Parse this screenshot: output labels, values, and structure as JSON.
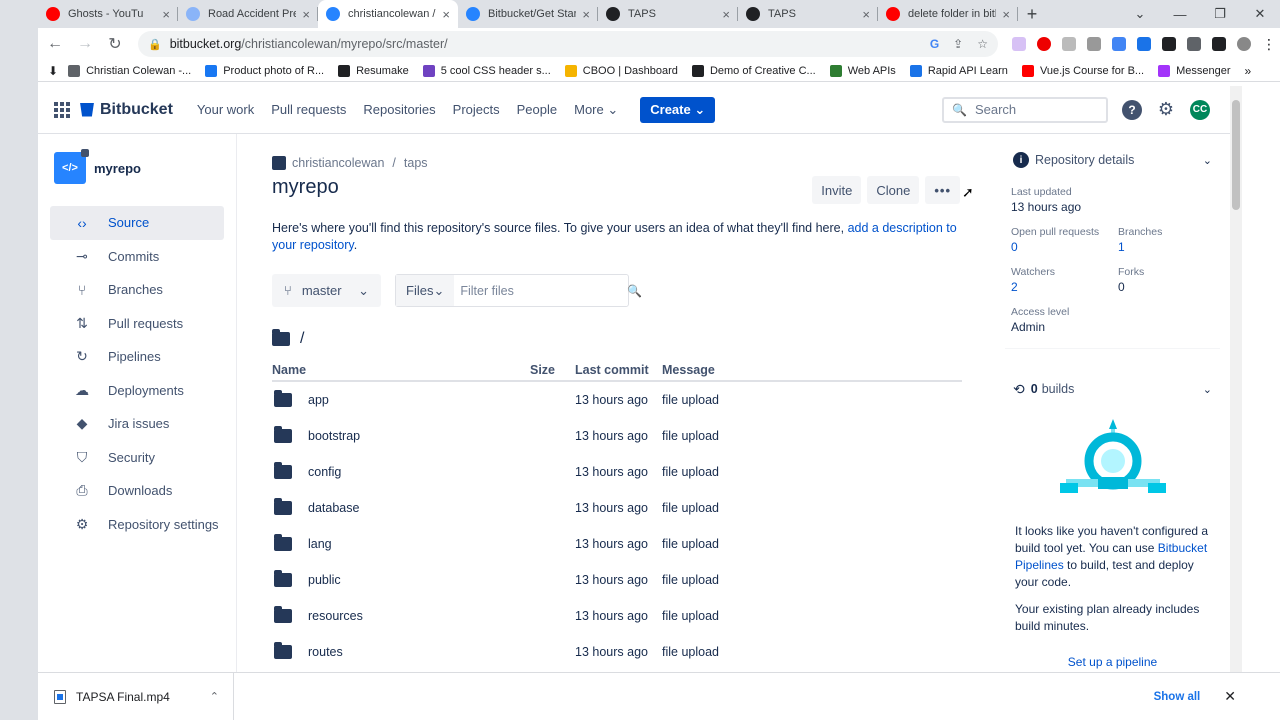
{
  "browser": {
    "tabs": [
      {
        "title": "Ghosts - YouTu",
        "color": "#ff0000",
        "active": false
      },
      {
        "title": "Road Accident Pre",
        "color": "#8ab4f8",
        "active": false
      },
      {
        "title": "christiancolewan / r",
        "color": "#2684ff",
        "active": true
      },
      {
        "title": "Bitbucket/Get Start",
        "color": "#2684ff",
        "active": false
      },
      {
        "title": "TAPS",
        "color": "#202124",
        "active": false
      },
      {
        "title": "TAPS",
        "color": "#202124",
        "active": false
      },
      {
        "title": "delete folder in bitb",
        "color": "#ff0000",
        "active": false
      }
    ],
    "url_host": "bitbucket.org",
    "url_path": "/christiancolewan/myrepo/src/master/",
    "bookmarks": [
      {
        "label": "Christian Colewan -...",
        "color": "#5f6368"
      },
      {
        "label": "Product photo of R...",
        "color": "#1877f2"
      },
      {
        "label": "Resumake",
        "color": "#202124"
      },
      {
        "label": "5 cool CSS header s...",
        "color": "#6f42c1"
      },
      {
        "label": "CBOO | Dashboard",
        "color": "#f5b400"
      },
      {
        "label": "Demo of Creative C...",
        "color": "#202124"
      },
      {
        "label": "Web APIs",
        "color": "#2e7d32"
      },
      {
        "label": "Rapid API Learn",
        "color": "#1a73e8"
      },
      {
        "label": "Vue.js Course for B...",
        "color": "#ff0000"
      },
      {
        "label": "Messenger",
        "color": "#a334fa"
      }
    ]
  },
  "header": {
    "logo": "Bitbucket",
    "nav": [
      "Your work",
      "Pull requests",
      "Repositories",
      "Projects",
      "People",
      "More"
    ],
    "create_label": "Create",
    "search_placeholder": "Search",
    "avatar_initials": "CC"
  },
  "sidebar": {
    "repo_name": "myrepo",
    "items": [
      {
        "label": "Source",
        "icon": "code-icon",
        "active": true
      },
      {
        "label": "Commits",
        "icon": "commit-icon",
        "active": false
      },
      {
        "label": "Branches",
        "icon": "branch-icon",
        "active": false
      },
      {
        "label": "Pull requests",
        "icon": "pull-request-icon",
        "active": false
      },
      {
        "label": "Pipelines",
        "icon": "pipeline-icon",
        "active": false
      },
      {
        "label": "Deployments",
        "icon": "cloud-icon",
        "active": false
      },
      {
        "label": "Jira issues",
        "icon": "jira-icon",
        "active": false
      },
      {
        "label": "Security",
        "icon": "shield-icon",
        "active": false
      },
      {
        "label": "Downloads",
        "icon": "download-icon",
        "active": false
      },
      {
        "label": "Repository settings",
        "icon": "gear-icon",
        "active": false
      }
    ]
  },
  "main": {
    "breadcrumb_owner": "christiancolewan",
    "breadcrumb_project": "taps",
    "title": "myrepo",
    "actions": {
      "invite": "Invite",
      "clone": "Clone",
      "more": "•••"
    },
    "description_prefix": "Here's where you'll find this repository's source files. To give your users an idea of what they'll find here,",
    "description_link": "add a description to your repository",
    "description_suffix": ".",
    "branch": "master",
    "filter_type": "Files",
    "filter_placeholder": "Filter files",
    "path": "/",
    "columns": {
      "name": "Name",
      "size": "Size",
      "last_commit": "Last commit",
      "message": "Message"
    },
    "rows": [
      {
        "name": "app",
        "size": "",
        "last_commit": "13 hours ago",
        "message": "file upload"
      },
      {
        "name": "bootstrap",
        "size": "",
        "last_commit": "13 hours ago",
        "message": "file upload"
      },
      {
        "name": "config",
        "size": "",
        "last_commit": "13 hours ago",
        "message": "file upload"
      },
      {
        "name": "database",
        "size": "",
        "last_commit": "13 hours ago",
        "message": "file upload"
      },
      {
        "name": "lang",
        "size": "",
        "last_commit": "13 hours ago",
        "message": "file upload"
      },
      {
        "name": "public",
        "size": "",
        "last_commit": "13 hours ago",
        "message": "file upload"
      },
      {
        "name": "resources",
        "size": "",
        "last_commit": "13 hours ago",
        "message": "file upload"
      },
      {
        "name": "routes",
        "size": "",
        "last_commit": "13 hours ago",
        "message": "file upload"
      }
    ]
  },
  "details": {
    "title": "Repository details",
    "last_updated_label": "Last updated",
    "last_updated": "13 hours ago",
    "open_prs_label": "Open pull requests",
    "open_prs": "0",
    "branches_label": "Branches",
    "branches": "1",
    "watchers_label": "Watchers",
    "watchers": "2",
    "forks_label": "Forks",
    "forks": "0",
    "access_label": "Access level",
    "access": "Admin",
    "builds_count": "0",
    "builds_label": "builds",
    "builds_text_prefix": "It looks like you haven't configured a build tool yet. You can use",
    "builds_link": "Bitbucket Pipelines",
    "builds_text_suffix": "to build, test and deploy your code.",
    "plan_text": "Your existing plan already includes build minutes.",
    "setup_link": "Set up a pipeline"
  },
  "downloads": {
    "file": "TAPSA Final.mp4",
    "show_all": "Show all"
  }
}
